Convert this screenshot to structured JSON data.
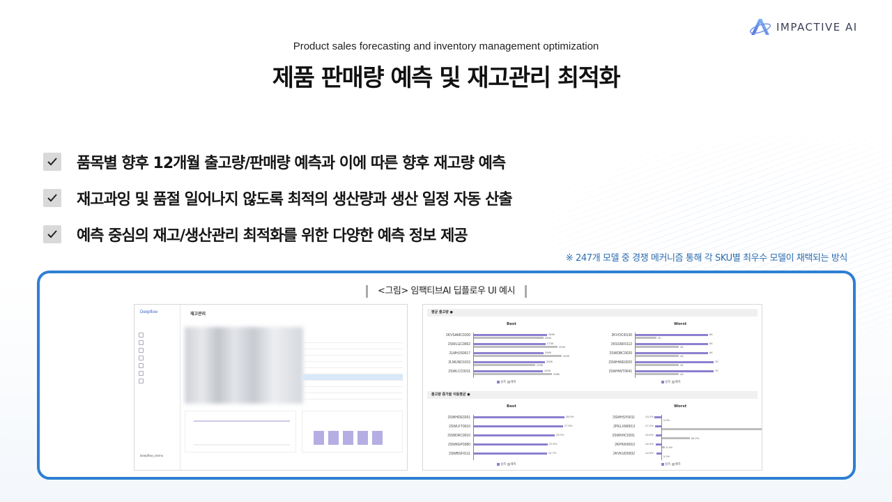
{
  "brand": {
    "name": "IMPACTIVE AI"
  },
  "header": {
    "subtitle": "Product sales forecasting and inventory management optimization",
    "title": "제품 판매량 예측 및 재고관리 최적화"
  },
  "bullets": [
    "품목별 향후 12개월 출고량/판매량 예측과 이에 따른 향후 재고량 예측",
    "재고과잉 및 품절 일어나지 않도록 최적의 생산량과 생산 일정 자동 산출",
    "예측 중심의 재고/생산관리 최적화를 위한 다양한 예측 정보 제공"
  ],
  "note": "※ 247개 모델 중 경쟁 메커니즘 통해 각 SKU별 최우수 모델이 채택되는 방식",
  "figure": {
    "caption": "<그림> 임팩티브AI 딥플로우 UI 예시",
    "left_app": {
      "brand": "Deepflow",
      "page_title": "재고관리",
      "user": "Deepflow_Demo"
    },
    "right_app": {
      "section1_title": "평균 출고량 ●",
      "section2_title": "출고량 증가율 이동평균 ●",
      "best_label": "Best",
      "worst_label": "Worst",
      "legend_actual": "실측",
      "legend_pred": "예측",
      "s1_best_labels": [
        "2KVSAMC0100",
        "2SWLGC0062",
        "2LMHJS0017",
        "2LMUND1015",
        "2SWLCC0011"
      ],
      "s1_best_values_a": [
        "283K",
        "273K",
        "246K",
        "253K",
        "245K"
      ],
      "s1_best_values_b": [
        "280K",
        "320K",
        "329K",
        "225K",
        "298K"
      ],
      "s1_worst_labels": [
        "2KVOCI0130",
        "2KSSNF0112",
        "2SWDBC0020",
        "2SWHWE0020",
        "2SWHWT0041"
      ],
      "s1_worst_values_a": [
        "6K",
        "6K",
        "6K",
        "7K",
        "7K"
      ],
      "s1_worst_values_b": [
        "2K",
        "4K",
        "4K",
        "4K",
        "4K"
      ],
      "s2_best_labels": [
        "2SWHDE0261",
        "2SWLFT0010",
        "2SWDRC0010",
        "2SWKEP0380",
        "2SWBSF0111"
      ],
      "s2_best_values": [
        "28.0%",
        "27.5%",
        "25.0%",
        "22.9%",
        "22.7%"
      ],
      "s2_worst_labels": [
        "2SWHSY0011",
        "2PELXM0013",
        "2SWKHC0201",
        "2KPKRI0010",
        "2KVKUD0032"
      ],
      "s2_worst_values_a": [
        "-19.2%",
        "-17.2%",
        "-15.0%",
        "-16.4%",
        "-14.5%"
      ],
      "s2_worst_values_b": [
        "0.0%",
        "250.0%",
        "66.2%",
        "6.3%",
        "0.0%"
      ]
    }
  }
}
